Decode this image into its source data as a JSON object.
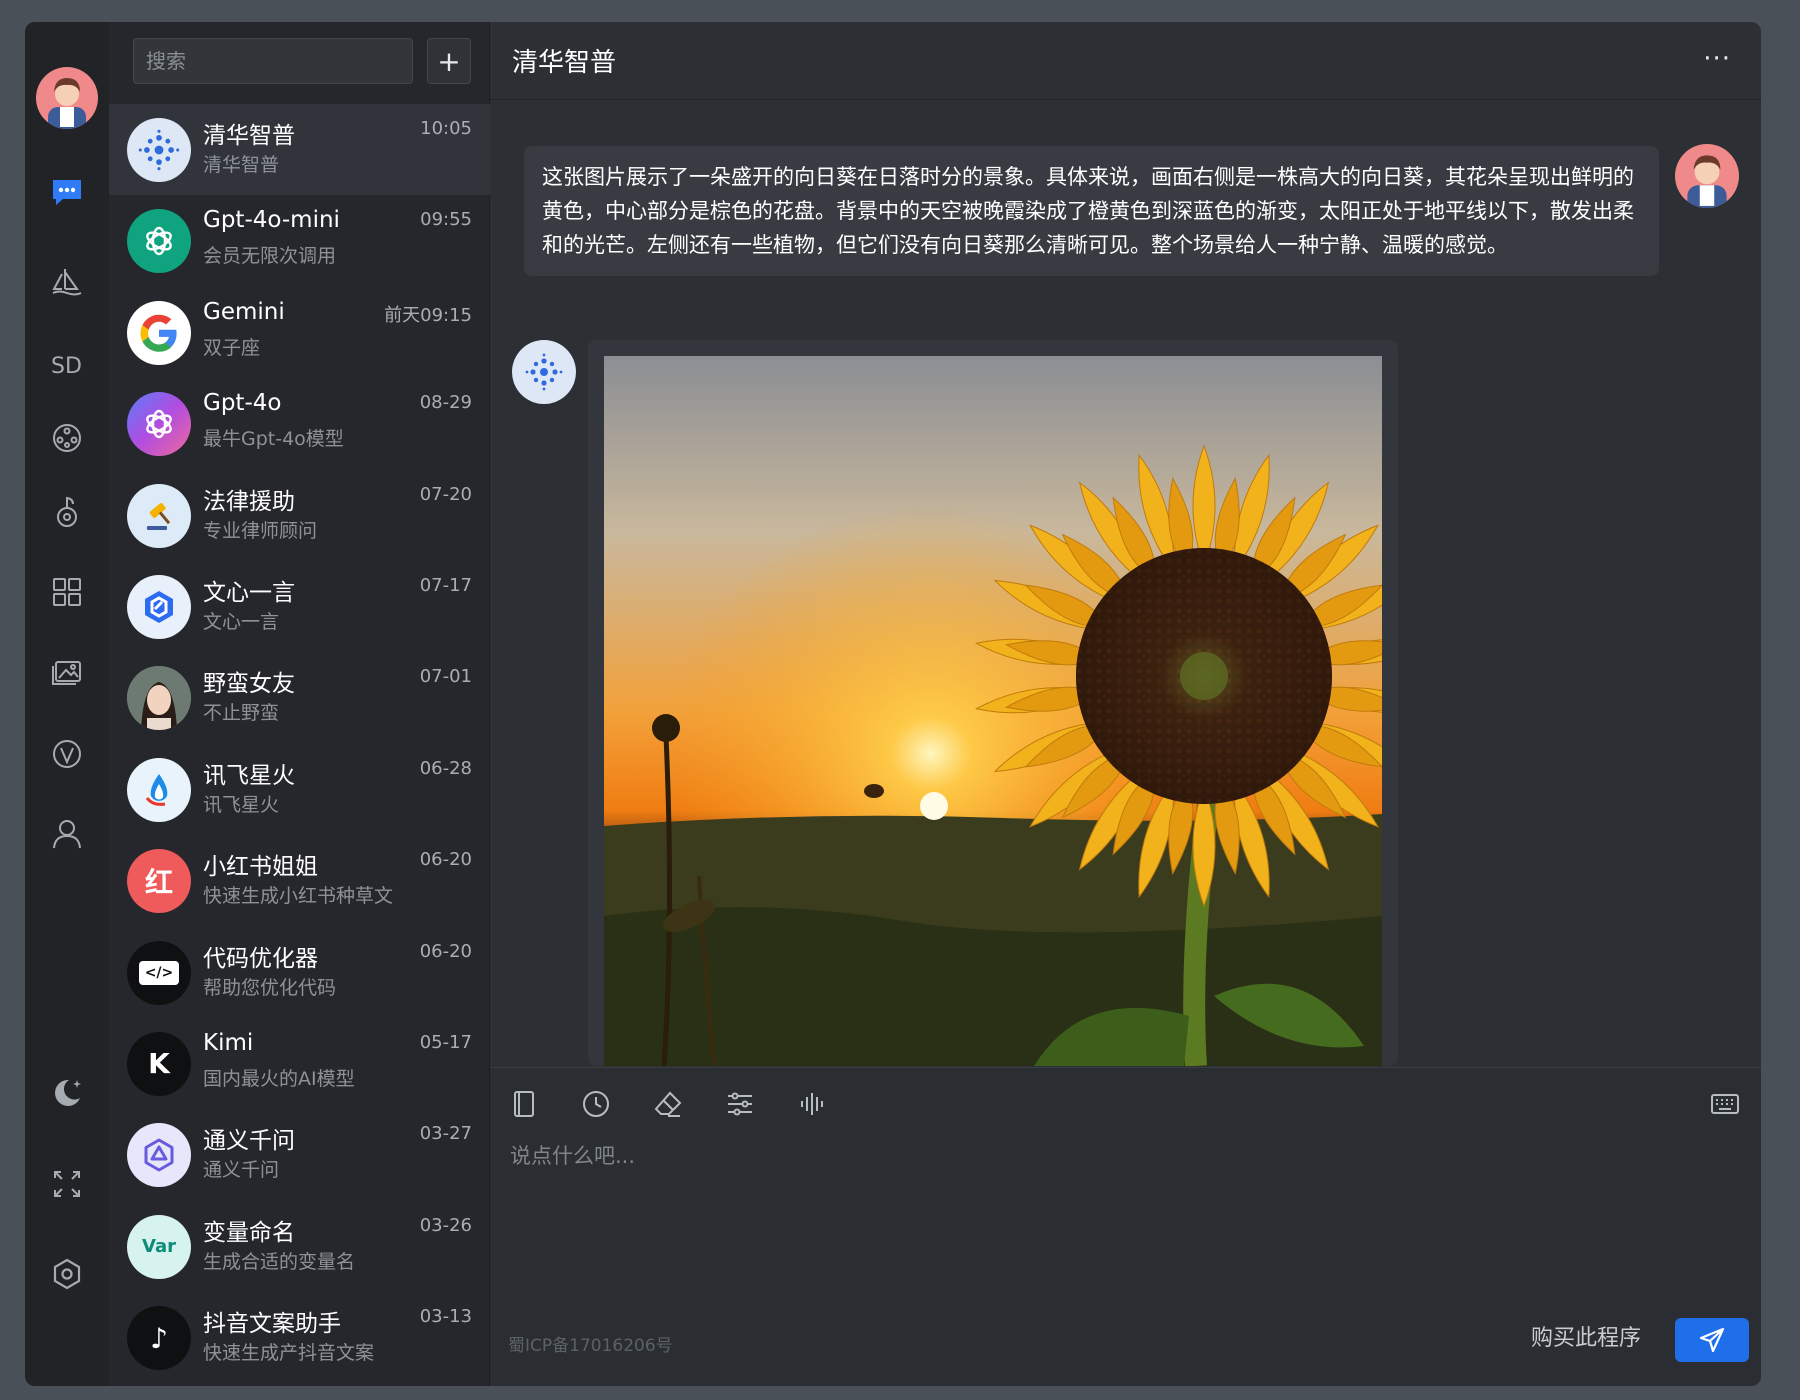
{
  "search": {
    "placeholder": "搜索"
  },
  "list_add": "+",
  "conversations": [
    {
      "name": "清华智普",
      "sub": "清华智普",
      "time": "10:05",
      "icon": "zhipu-icon"
    },
    {
      "name": "Gpt-4o-mini",
      "sub": "会员无限次调用",
      "time": "09:55",
      "icon": "openai-icon"
    },
    {
      "name": "Gemini",
      "sub": "双子座",
      "time": "前天09:15",
      "icon": "google-icon"
    },
    {
      "name": "Gpt-4o",
      "sub": "最牛Gpt-4o模型",
      "time": "08-29",
      "icon": "openai-gradient-icon"
    },
    {
      "name": "法律援助",
      "sub": "专业律师顾问",
      "time": "07-20",
      "icon": "gavel-icon"
    },
    {
      "name": "文心一言",
      "sub": "文心一言",
      "time": "07-17",
      "icon": "wenxin-icon"
    },
    {
      "name": "野蛮女友",
      "sub": "不止野蛮",
      "time": "07-01",
      "icon": "girl-avatar-icon"
    },
    {
      "name": "讯飞星火",
      "sub": "讯飞星火",
      "time": "06-28",
      "icon": "spark-icon"
    },
    {
      "name": "小红书姐姐",
      "sub": "快速生成小红书种草文",
      "time": "06-20",
      "icon": "xiaohongshu-icon",
      "badge": "红"
    },
    {
      "name": "代码优化器",
      "sub": "帮助您优化代码",
      "time": "06-20",
      "icon": "code-icon",
      "badge": "</>"
    },
    {
      "name": "Kimi",
      "sub": "国内最火的AI模型",
      "time": "05-17",
      "icon": "kimi-icon",
      "badge": "K"
    },
    {
      "name": "通义千问",
      "sub": "通义千问",
      "time": "03-27",
      "icon": "tongyi-icon"
    },
    {
      "name": "变量命名",
      "sub": "生成合适的变量名",
      "time": "03-26",
      "icon": "var-icon",
      "badge": "Var"
    },
    {
      "name": "抖音文案助手",
      "sub": "快速生成产抖音文案",
      "time": "03-13",
      "icon": "douyin-icon",
      "badge": "♪"
    }
  ],
  "header": {
    "title": "清华智普",
    "more": "···"
  },
  "messages": {
    "user_text": "这张图片展示了一朵盛开的向日葵在日落时分的景象。具体来说，画面右侧是一株高大的向日葵，其花朵呈现出鲜明的黄色，中心部分是棕色的花盘。背景中的天空被晚霞染成了橙黄色到深蓝色的渐变，太阳正处于地平线以下，散发出柔和的光芒。左侧还有一些植物，但它们没有向日葵那么清晰可见。整个场景给人一种宁静、温暖的感觉。"
  },
  "composer": {
    "placeholder": "说点什么吧...",
    "icp": "蜀ICP备17016206号",
    "buy_label": "购买此程序"
  },
  "colors": {
    "accent": "#1f6feb",
    "rail_active": "#2f7cf6"
  }
}
